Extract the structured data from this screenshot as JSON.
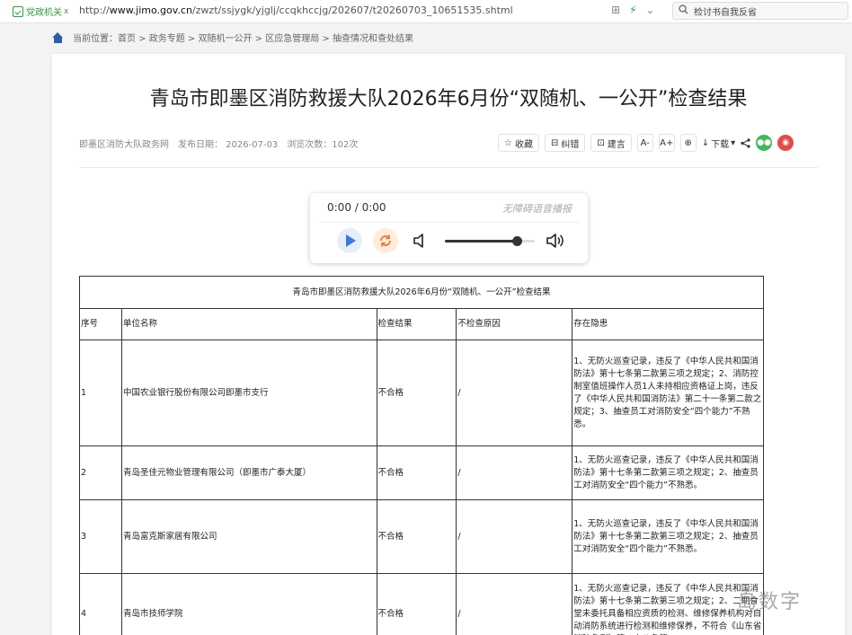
{
  "browser": {
    "site_tag": "党政机关",
    "site_tag_x": "x",
    "url_prefix": "http://",
    "url_host": "www.jimo.gov.cn",
    "url_path": "/zwzt/ssjygk/yjglj/ccqkhccjg/202607/t20260703_10651535.shtml",
    "search_text": "检讨书自我反省"
  },
  "breadcrumb": "当前位置：首页 > 政务专题 > 双随机一公开 > 区应急管理局 > 抽查情况和查处结果",
  "article": {
    "title": "青岛市即墨区消防救援大队2026年6月份“双随机、一公开”检查结果",
    "source": "即墨区消防大队政务网",
    "publish_date": "发布日期： 2026-07-03",
    "views": "浏览次数：102次"
  },
  "tools": {
    "collect": "收藏",
    "correct": "纠错",
    "suggest": "建言",
    "font_down": "A-",
    "font_up": "A+",
    "print": "⊕",
    "download": "下载"
  },
  "player": {
    "time": "0:00 / 0:00",
    "label": "无障碍语音播报",
    "volume": 0.8
  },
  "table": {
    "caption": "青岛市即墨区消防救援大队2026年6月份“双随机、一公开”检查结果",
    "headers": [
      "序号",
      "单位名称",
      "检查结果",
      "不检查原因",
      "存在隐患"
    ],
    "rows": [
      {
        "no": "1",
        "name": "中国农业银行股份有限公司即墨市支行",
        "result": "不合格",
        "reason": "/",
        "hazard": "1、无防火巡查记录，违反了《中华人民共和国消防法》第十七条第二款第三项之规定；2、消防控制室值班操作人员1人未持相应资格证上岗，违反了《中华人民共和国消防法》第二十一条第二款之规定；3、抽查员工对消防安全“四个能力”不熟悉。"
      },
      {
        "no": "2",
        "name": "青岛圣佳元物业管理有限公司（即墨市广泰大厦）",
        "result": "不合格",
        "reason": "/",
        "hazard": "1、无防火巡查记录，违反了《中华人民共和国消防法》第十七条第二款第三项之规定；2、抽查员工对消防安全“四个能力”不熟悉。"
      },
      {
        "no": "3",
        "name": "青岛富克斯家居有限公司",
        "result": "不合格",
        "reason": "/",
        "hazard": "1、无防火巡查记录，违反了《中华人民共和国消防法》第十七条第二款第三项之规定；2、抽查员工对消防安全“四个能力”不熟悉。"
      },
      {
        "no": "4",
        "name": "青岛市技师学院",
        "result": "不合格",
        "reason": "/",
        "hazard": "1、无防火巡查记录，违反了《中华人民共和国消防法》第十七条第二款第三项之规定；2、二期食堂未委托具备相应资质的检测、维修保养机构对自动消防系统进行检测和维修保养，不符合《山东省消防条例》第二十八条第"
      }
    ]
  },
  "watermark": "岛数字"
}
